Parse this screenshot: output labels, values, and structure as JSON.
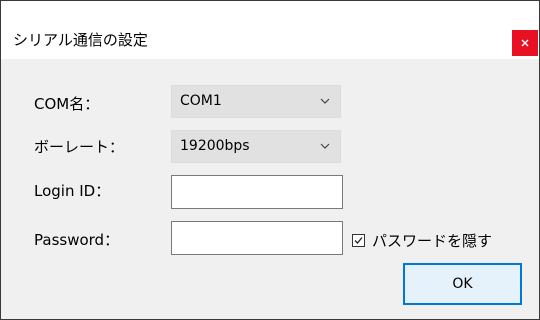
{
  "window": {
    "title": "シリアル通信の設定",
    "close_label": "x"
  },
  "form": {
    "com": {
      "label": "COM名：",
      "selected": "COM1"
    },
    "baud": {
      "label": "ボーレート：",
      "selected": "19200bps"
    },
    "login": {
      "label": "Login ID：",
      "value": ""
    },
    "password": {
      "label": "Password：",
      "value": ""
    },
    "hide_password": {
      "label": "パスワードを隠す",
      "checked": true
    }
  },
  "buttons": {
    "ok_label": "OK"
  },
  "colors": {
    "close_button": "#e81123",
    "ok_border": "#0078d7",
    "ok_fill": "#e5f1fb",
    "dialog_background": "#f0f0f0",
    "combo_background": "#e1e1e1"
  },
  "icons": {
    "close": "close-icon",
    "dropdown": "chevron-down-icon",
    "checkbox": "check-icon"
  }
}
